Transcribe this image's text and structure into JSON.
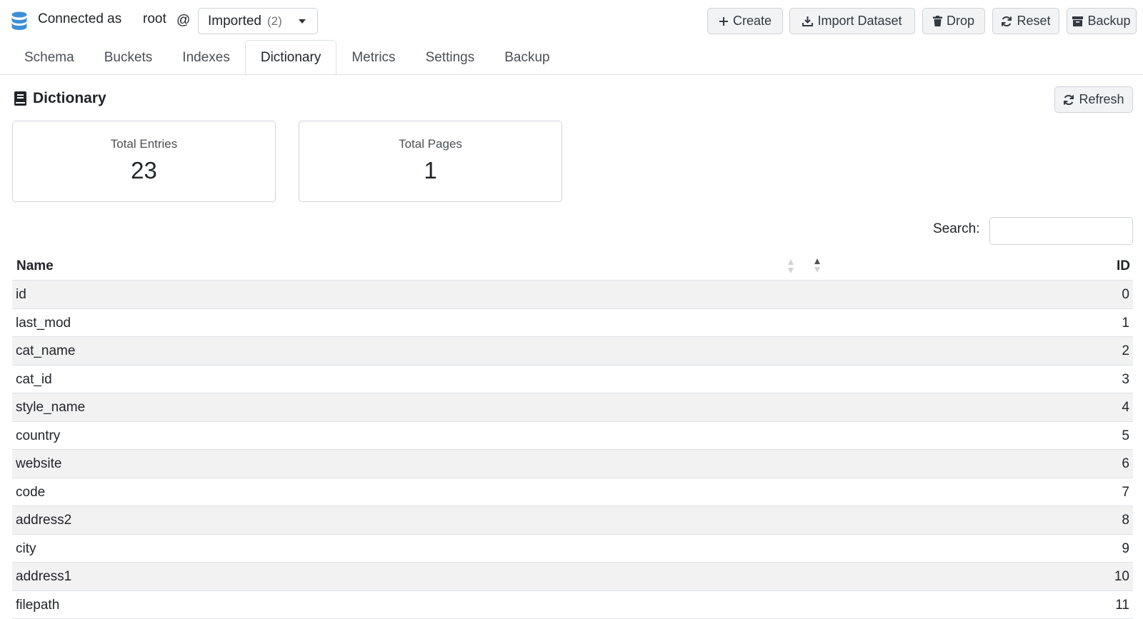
{
  "connection": {
    "label": "Connected as",
    "user": "root",
    "at": "@",
    "dataset": "Imported",
    "dataset_count": "(2)"
  },
  "toolbar": {
    "create": "Create",
    "import": "Import Dataset",
    "drop": "Drop",
    "reset": "Reset",
    "backup": "Backup"
  },
  "tabs": [
    "Schema",
    "Buckets",
    "Indexes",
    "Dictionary",
    "Metrics",
    "Settings",
    "Backup"
  ],
  "active_tab": "Dictionary",
  "section": {
    "title": "Dictionary",
    "refresh": "Refresh"
  },
  "stats": {
    "total_entries_label": "Total Entries",
    "total_entries": "23",
    "total_pages_label": "Total Pages",
    "total_pages": "1"
  },
  "search": {
    "label": "Search:",
    "value": ""
  },
  "table": {
    "headers": {
      "name": "Name",
      "id": "ID"
    },
    "rows": [
      {
        "name": "id",
        "id": "0"
      },
      {
        "name": "last_mod",
        "id": "1"
      },
      {
        "name": "cat_name",
        "id": "2"
      },
      {
        "name": "cat_id",
        "id": "3"
      },
      {
        "name": "style_name",
        "id": "4"
      },
      {
        "name": "country",
        "id": "5"
      },
      {
        "name": "website",
        "id": "6"
      },
      {
        "name": "code",
        "id": "7"
      },
      {
        "name": "address2",
        "id": "8"
      },
      {
        "name": "city",
        "id": "9"
      },
      {
        "name": "address1",
        "id": "10"
      },
      {
        "name": "filepath",
        "id": "11"
      }
    ]
  },
  "colors": {
    "db_icon": "#3d8fd6",
    "button_bg": "#f1f3f5",
    "stripe": "#f2f2f2",
    "border": "#dee2e6"
  }
}
